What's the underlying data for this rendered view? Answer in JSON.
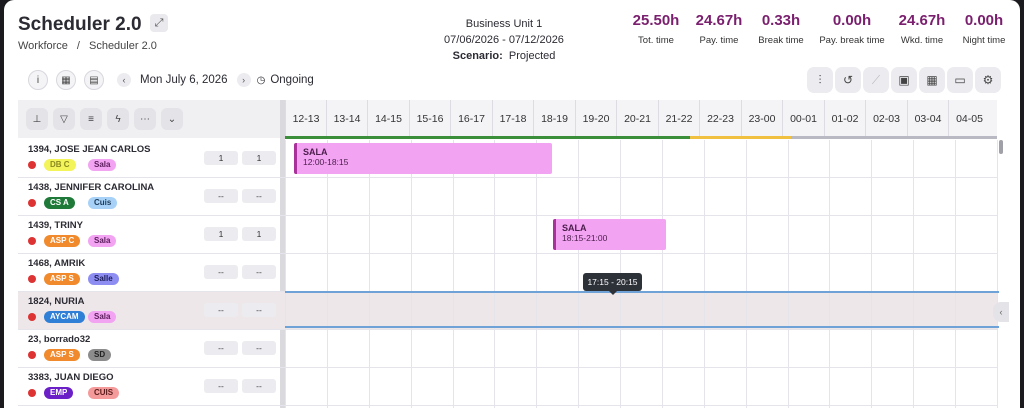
{
  "header": {
    "title": "Scheduler 2.0",
    "breadcrumb": [
      "Workforce",
      "Scheduler 2.0"
    ],
    "breadcrumb_sep": "/"
  },
  "business": {
    "unit": "Business Unit 1",
    "range": "07/06/2026 - 07/12/2026",
    "scenario_label": "Scenario:",
    "scenario": "Projected"
  },
  "metrics": [
    {
      "value": "25.50h",
      "label": "Tot. time"
    },
    {
      "value": "24.67h",
      "label": "Pay. time"
    },
    {
      "value": "0.33h",
      "label": "Break time"
    },
    {
      "value": "0.00h",
      "label": "Pay. break time"
    },
    {
      "value": "24.67h",
      "label": "Wkd. time"
    },
    {
      "value": "0.00h",
      "label": "Night time"
    }
  ],
  "toolbar": {
    "date": "Mon July 6, 2026",
    "status": "Ongoing",
    "prev_icon": "chevron-left-icon",
    "next_icon": "chevron-right-icon"
  },
  "hours": [
    "12-13",
    "13-14",
    "14-15",
    "15-16",
    "16-17",
    "17-18",
    "18-19",
    "19-20",
    "20-21",
    "21-22",
    "22-23",
    "23-00",
    "00-01",
    "01-02",
    "02-03",
    "03-04",
    "04-05"
  ],
  "coverage_colors": {
    "green": "#3b8f3b",
    "yellow": "#f0c040",
    "grey": "#b9b9c4"
  },
  "employees": [
    {
      "name": "1394, JOSE JEAN CARLOS",
      "tags": [
        {
          "text": "DB C",
          "bg": "#f3f35a",
          "fg": "#8a8a20"
        },
        {
          "text": "Sala",
          "bg": "#f2a3f2",
          "fg": "#5a1d5a"
        }
      ],
      "v1": "1",
      "v2": "1"
    },
    {
      "name": "1438, JENNIFER CAROLINA",
      "tags": [
        {
          "text": "CS A",
          "bg": "#1f7a3a",
          "fg": "#ffffff"
        },
        {
          "text": "Cuis",
          "bg": "#a7d1f7",
          "fg": "#1d3b5a"
        }
      ],
      "v1": "--",
      "v2": "--"
    },
    {
      "name": "1439, TRINY",
      "tags": [
        {
          "text": "ASP C",
          "bg": "#f08a2c",
          "fg": "#ffffff"
        },
        {
          "text": "Sala",
          "bg": "#f2a3f2",
          "fg": "#5a1d5a"
        }
      ],
      "v1": "1",
      "v2": "1"
    },
    {
      "name": "1468, AMRIK",
      "tags": [
        {
          "text": "ASP S",
          "bg": "#f08a2c",
          "fg": "#ffffff"
        },
        {
          "text": "Salle",
          "bg": "#8d8df2",
          "fg": "#1d1d5a"
        }
      ],
      "v1": "--",
      "v2": "--"
    },
    {
      "name": "1824, NURIA",
      "tags": [
        {
          "text": "AYCAM",
          "bg": "#2f7fd6",
          "fg": "#ffffff"
        },
        {
          "text": "Sala",
          "bg": "#f2a3f2",
          "fg": "#5a1d5a"
        }
      ],
      "v1": "--",
      "v2": "--"
    },
    {
      "name": "23, borrado32",
      "tags": [
        {
          "text": "ASP S",
          "bg": "#f08a2c",
          "fg": "#ffffff"
        },
        {
          "text": "SD",
          "bg": "#8c8c8c",
          "fg": "#222222"
        }
      ],
      "v1": "--",
      "v2": "--"
    },
    {
      "name": "3383, JUAN DIEGO",
      "tags": [
        {
          "text": "EMP",
          "bg": "#6a1fc7",
          "fg": "#ffffff"
        },
        {
          "text": "CUIS",
          "bg": "#f59a9a",
          "fg": "#5a1d1d"
        }
      ],
      "v1": "--",
      "v2": "--"
    }
  ],
  "shifts": [
    {
      "label": "SALA",
      "time": "12:00-18:15"
    },
    {
      "label": "SALA",
      "time": "18:15-21:00"
    }
  ],
  "tooltip": "17:15 - 20:15"
}
